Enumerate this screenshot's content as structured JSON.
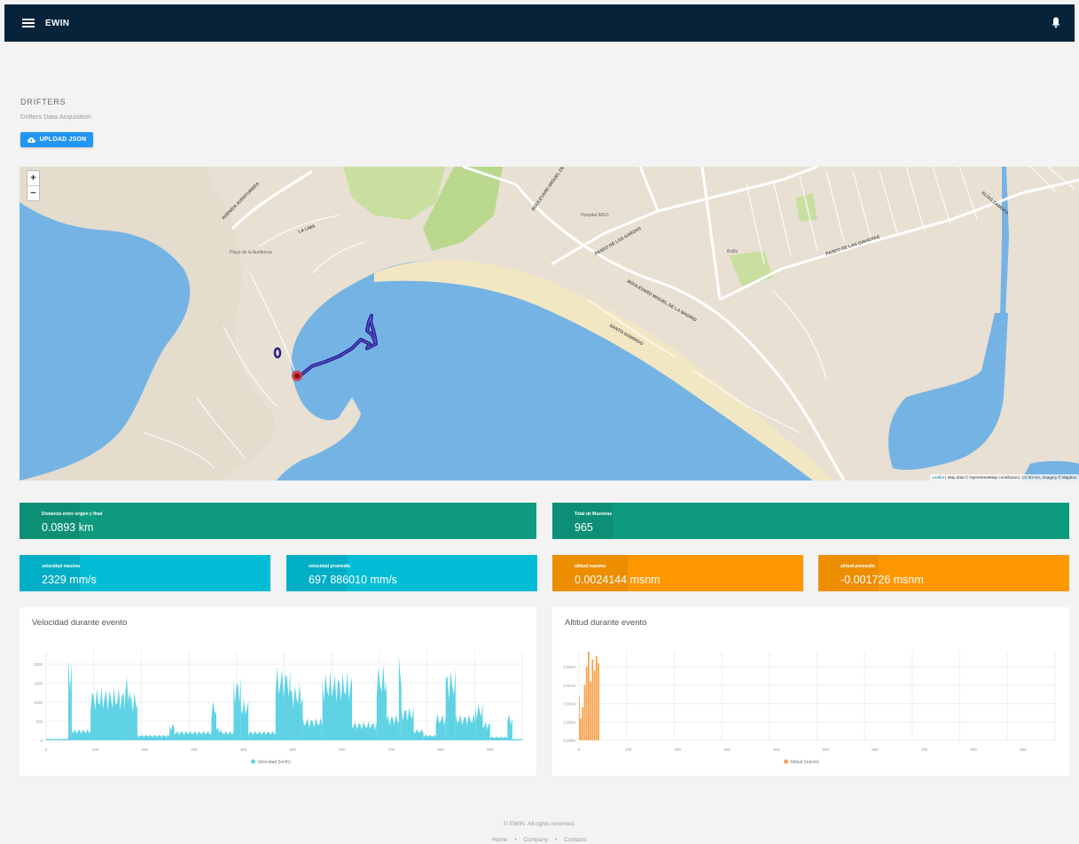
{
  "header": {
    "brand": "EWIN",
    "menu_icon": "hamburger-menu-icon",
    "notification_icon": "bell-icon",
    "background": "#062339"
  },
  "page": {
    "title": "DRIFTERS",
    "subtitle": "Drifters Data Acquisition",
    "upload_label": "UPLOAD JSON",
    "upload_icon": "cloud-upload-icon"
  },
  "map": {
    "zoom_in": "+",
    "zoom_out": "−",
    "attribution_leaflet": "Leaflet",
    "attribution_text": " | Map data © OpenStreetMap contributors, CC-BY-SA, Imagery © Mapbox",
    "labels": {
      "avenida": "AVENIDA AVENTURERA",
      "boulevard1": "BOULEVARD MIGUEL DE LA MADRID",
      "boulevard2": "BOULEVARD MIGUEL DE LA MADRID",
      "paseo1": "PASEO DE LAS GARZAS",
      "paseo2": "PASEO DE LAS GAVIOTAS",
      "hospital": "Hospital IMSS",
      "santo": "SANTO DOMINGO",
      "laas": "LA LIMA",
      "elias": "ELÍAS ZAMORA",
      "puerta": "Playa de la Audiencia",
      "bullo": "Bulllo"
    },
    "track_color": "#2a1d8a",
    "marker_color": "#d63340"
  },
  "stats": {
    "distance": {
      "label": "Distancia entre origen y final",
      "value": "0.0893 km"
    },
    "total": {
      "label": "Total de Muestras",
      "value": "965"
    },
    "vmax": {
      "label": "velocidad maxima",
      "value": "2329 mm/s"
    },
    "vavg": {
      "label": "velocidad promedio",
      "value": "697 886010 mm/s"
    },
    "amax": {
      "label": "altitud maxima",
      "value": "0.0024144 msnm"
    },
    "aavg": {
      "label": "altitud promedio",
      "value": "-0.001726 msnm"
    },
    "colors": {
      "green": "#0e9a7e",
      "cyan": "#00bcd4",
      "orange": "#ff9800"
    }
  },
  "charts": {
    "velocity_title": "Velocidad durante evento",
    "altitude_title": "Altitud durante evento"
  },
  "chart_data": [
    {
      "type": "area",
      "title": "Velocidad durante evento",
      "series": [
        {
          "name": "Velocidad (km/h)",
          "color": "#5fd3e4"
        }
      ],
      "xlim": [
        0,
        965
      ],
      "ylim": [
        0,
        2329
      ],
      "xticks": [
        "0",
        "100",
        "200",
        "300",
        "400",
        "500",
        "600",
        "700",
        "800",
        "900"
      ],
      "yticks": [
        "0",
        "500",
        "1000",
        "1500",
        "2000"
      ],
      "segments": [
        {
          "x0": 0,
          "x1": 45,
          "level": 40
        },
        {
          "x0": 45,
          "x1": 52,
          "level": 2300
        },
        {
          "x0": 52,
          "x1": 90,
          "level": 300
        },
        {
          "x0": 90,
          "x1": 160,
          "level": 1400
        },
        {
          "x0": 160,
          "x1": 170,
          "level": 1700
        },
        {
          "x0": 170,
          "x1": 185,
          "level": 1300
        },
        {
          "x0": 185,
          "x1": 250,
          "level": 150
        },
        {
          "x0": 250,
          "x1": 260,
          "level": 450
        },
        {
          "x0": 260,
          "x1": 335,
          "level": 250
        },
        {
          "x0": 335,
          "x1": 345,
          "level": 1050
        },
        {
          "x0": 345,
          "x1": 355,
          "level": 350
        },
        {
          "x0": 355,
          "x1": 380,
          "level": 250
        },
        {
          "x0": 380,
          "x1": 395,
          "level": 1700
        },
        {
          "x0": 395,
          "x1": 410,
          "level": 1100
        },
        {
          "x0": 410,
          "x1": 465,
          "level": 250
        },
        {
          "x0": 465,
          "x1": 495,
          "level": 1950
        },
        {
          "x0": 495,
          "x1": 520,
          "level": 1500
        },
        {
          "x0": 520,
          "x1": 560,
          "level": 600
        },
        {
          "x0": 560,
          "x1": 620,
          "level": 1800
        },
        {
          "x0": 620,
          "x1": 670,
          "level": 500
        },
        {
          "x0": 670,
          "x1": 690,
          "level": 2000
        },
        {
          "x0": 690,
          "x1": 715,
          "level": 700
        },
        {
          "x0": 715,
          "x1": 720,
          "level": 2329
        },
        {
          "x0": 720,
          "x1": 745,
          "level": 900
        },
        {
          "x0": 745,
          "x1": 765,
          "level": 300
        },
        {
          "x0": 765,
          "x1": 790,
          "level": 150
        },
        {
          "x0": 790,
          "x1": 810,
          "level": 700
        },
        {
          "x0": 810,
          "x1": 830,
          "level": 1900
        },
        {
          "x0": 830,
          "x1": 870,
          "level": 700
        },
        {
          "x0": 870,
          "x1": 885,
          "level": 1000
        },
        {
          "x0": 885,
          "x1": 900,
          "level": 500
        },
        {
          "x0": 900,
          "x1": 935,
          "level": 100
        },
        {
          "x0": 935,
          "x1": 945,
          "level": 700
        },
        {
          "x0": 945,
          "x1": 965,
          "level": 40
        }
      ]
    },
    {
      "type": "bar",
      "title": "Altitud durante evento",
      "series": [
        {
          "name": "Altitud (msnm)",
          "color": "#f7a04a"
        }
      ],
      "xlim": [
        0,
        965
      ],
      "ylim": [
        0,
        0.0024144
      ],
      "xticks": [
        "0",
        "100",
        "200",
        "300",
        "400",
        "500",
        "600",
        "700",
        "800",
        "900"
      ],
      "yticks": [
        "0.0000",
        "0.0005",
        "0.0010",
        "0.0015",
        "0.0020"
      ],
      "segments": [
        {
          "x0": 0,
          "x1": 2,
          "level": 0.0012
        },
        {
          "x0": 2,
          "x1": 6,
          "level": 0.0006
        },
        {
          "x0": 6,
          "x1": 10,
          "level": 0.0009
        },
        {
          "x0": 10,
          "x1": 14,
          "level": 0.0015
        },
        {
          "x0": 14,
          "x1": 18,
          "level": 0.002
        },
        {
          "x0": 18,
          "x1": 22,
          "level": 0.0024144
        },
        {
          "x0": 22,
          "x1": 26,
          "level": 0.0016
        },
        {
          "x0": 26,
          "x1": 30,
          "level": 0.0022
        },
        {
          "x0": 30,
          "x1": 34,
          "level": 0.0019
        },
        {
          "x0": 34,
          "x1": 38,
          "level": 0.0023
        },
        {
          "x0": 38,
          "x1": 42,
          "level": 0.0021
        }
      ]
    }
  ],
  "footer": {
    "copyright": "© EWIN. All rights reserved.",
    "links": [
      "Home",
      "Company",
      "Contacts"
    ]
  }
}
